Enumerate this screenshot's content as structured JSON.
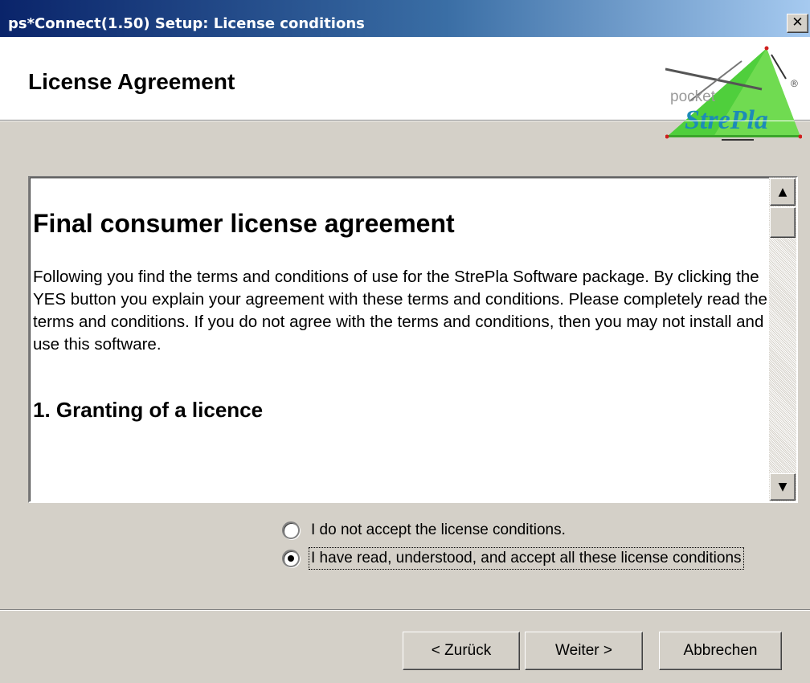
{
  "window": {
    "title": "ps*Connect(1.50) Setup: License conditions",
    "close_glyph": "✕"
  },
  "header": {
    "title": "License Agreement",
    "logo": {
      "top_text": "pocket",
      "main_text": "StrePla",
      "mark": "®"
    }
  },
  "license": {
    "heading": "Final consumer license agreement",
    "paragraph": "Following you find the terms and conditions of use for the StrePla Software package. By clicking the YES button you explain your agreement with these terms and conditions. Please completely read the terms and conditions. If you do not agree with the terms and conditions, then you may not install and use this software.",
    "section_heading": "1. Granting of a licence"
  },
  "scrollbar": {
    "up_glyph": "▲",
    "down_glyph": "▼"
  },
  "options": {
    "reject_label": "I do not accept the license conditions.",
    "accept_label": "I have read, understood, and accept all these license conditions",
    "selected": "accept"
  },
  "buttons": {
    "back": "< Zurück",
    "next": "Weiter >",
    "cancel": "Abbrechen"
  },
  "colors": {
    "title_gradient_start": "#0a246a",
    "title_gradient_end": "#a6caf0",
    "dialog_background": "#d4d0c8",
    "logo_green": "#4fcf3c"
  }
}
